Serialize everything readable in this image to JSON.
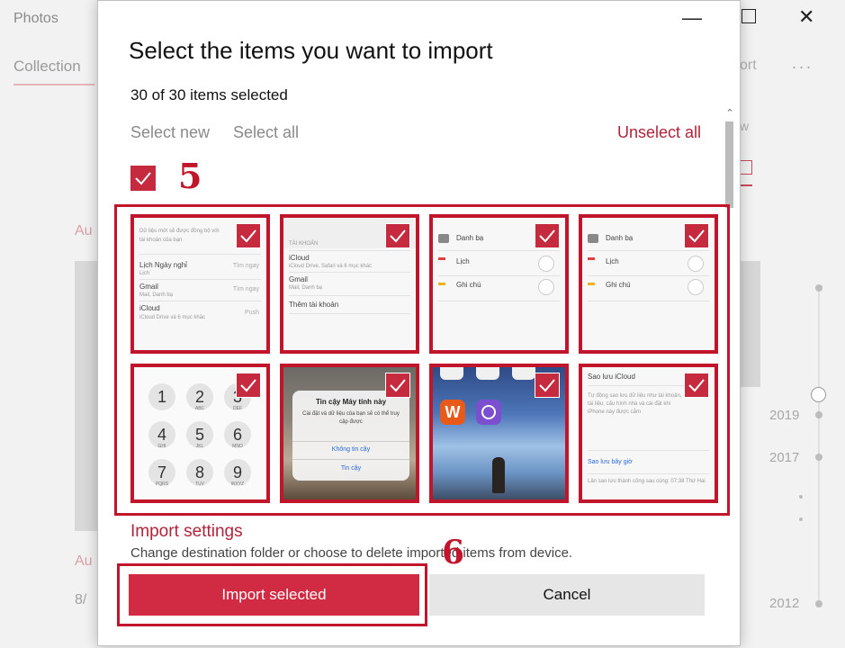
{
  "background": {
    "app_title": "Photos",
    "tab_collection": "Collection",
    "import_label": "ort",
    "more_label": "...",
    "view_label": "w",
    "au_label_1": "Au",
    "au_label_2": "Au",
    "date_label": "8/",
    "timeline_years": [
      "2019",
      "2017",
      "2012"
    ]
  },
  "dialog": {
    "title": "Select the items you want to import",
    "selected_count": "30 of 30 items selected",
    "select_new": "Select new",
    "select_all": "Select all",
    "unselect_all": "Unselect all",
    "annotation_5": "5",
    "annotation_6": "6",
    "import_settings_title": "Import settings",
    "import_settings_desc": "Change destination folder or choose to delete imported items from device.",
    "import_button": "Import selected",
    "cancel_button": "Cancel"
  },
  "thumbnails": {
    "t1": {
      "header1": "Dữ liệu mới sẽ được đồng bộ với",
      "header2": "tài khoản của bạn",
      "row1": "Lịch Ngày nghỉ",
      "row1_right": "Tìm ngay",
      "row1_sub": "Lịch",
      "row2": "Gmail",
      "row2_right": "Tìm ngay",
      "row2_sub": "Mail, Danh bạ",
      "row3": "iCloud",
      "row3_right": "Push",
      "row3_sub": "iCloud Drive và 6 mục khác"
    },
    "t2": {
      "section": "TÀI KHOẢN",
      "row1": "iCloud",
      "row1_sub": "iCloud Drive, Safari và 6 mục khác",
      "row2": "Gmail",
      "row2_sub": "Mail, Danh bạ",
      "row3": "Thêm tài khoản"
    },
    "t3": {
      "row1": "Danh bạ",
      "row2": "Lịch",
      "row3": "Ghi chú"
    },
    "t4": {
      "row1": "Danh bạ",
      "row2": "Lịch",
      "row3": "Ghi chú"
    },
    "t5": {
      "keys": [
        "1",
        "2",
        "3",
        "4",
        "5",
        "6",
        "7",
        "8",
        "9"
      ],
      "subs": [
        "",
        "ABC",
        "DEF",
        "GHI",
        "JKL",
        "MNO",
        "PQRS",
        "TUV",
        "WXYZ"
      ]
    },
    "t6": {
      "title": "Tin cậy Máy tính này",
      "body": "Cài đặt và dữ liệu của bạn sẽ có thể truy cập được",
      "btn1": "Không tin cậy",
      "btn2": "Tin cậy"
    },
    "t7": {
      "app": "W"
    },
    "t8": {
      "title": "Sao lưu iCloud",
      "body": "Tự động sao lưu dữ liệu như tài khoản, tài liệu, cấu hình nhà và cài đặt khi iPhone này được cắm",
      "link": "Sao lưu bây giờ",
      "footer": "Lần sao lưu thành công sau cùng: 07:38 Thứ Hai"
    }
  }
}
